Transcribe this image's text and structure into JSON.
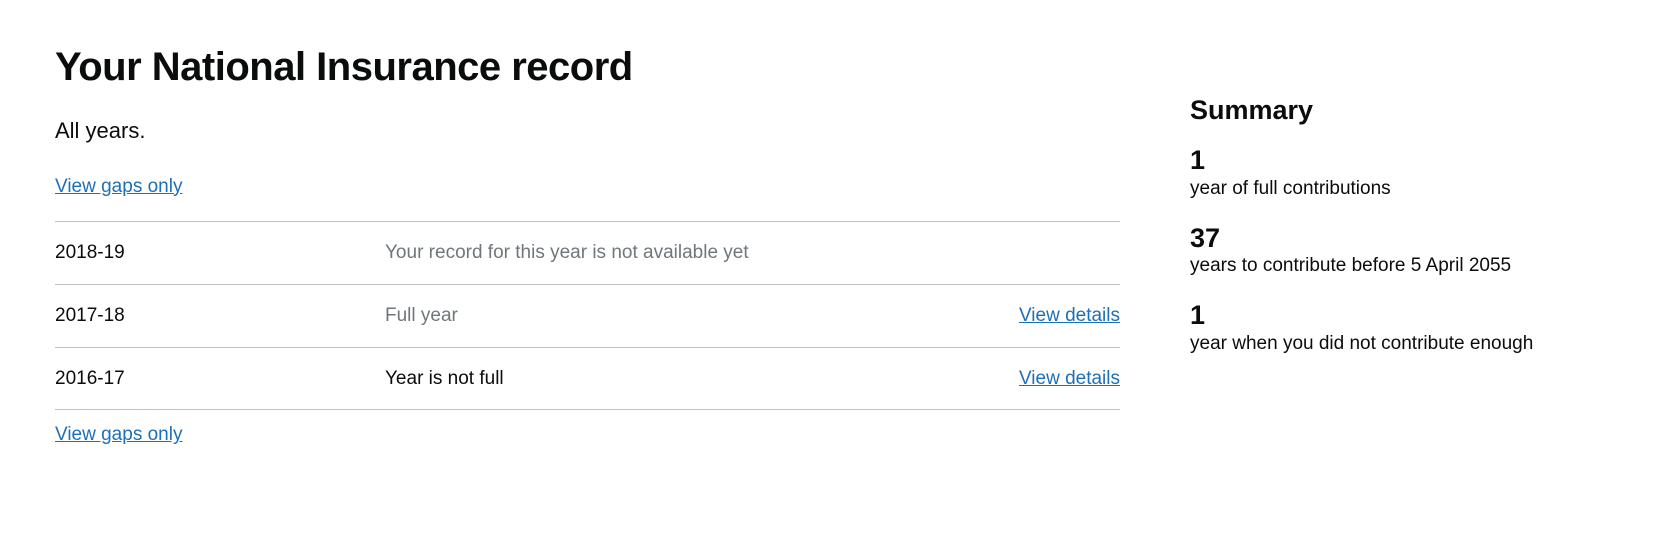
{
  "page_title": "Your National Insurance record",
  "subtitle": "All years.",
  "view_gaps_label": "View gaps only",
  "view_details_label": "View details",
  "rows": [
    {
      "year": "2018-19",
      "status": "Your record for this year is not available yet",
      "muted": true,
      "has_action": false
    },
    {
      "year": "2017-18",
      "status": "Full year",
      "muted": true,
      "has_action": true
    },
    {
      "year": "2016-17",
      "status": "Year is not full",
      "muted": false,
      "has_action": true
    }
  ],
  "summary": {
    "heading": "Summary",
    "stats": [
      {
        "num": "1",
        "desc": "year of full contributions"
      },
      {
        "num": "37",
        "desc": "years to contribute before 5 April 2055"
      },
      {
        "num": "1",
        "desc": "year when you did not contribute enough"
      }
    ]
  }
}
